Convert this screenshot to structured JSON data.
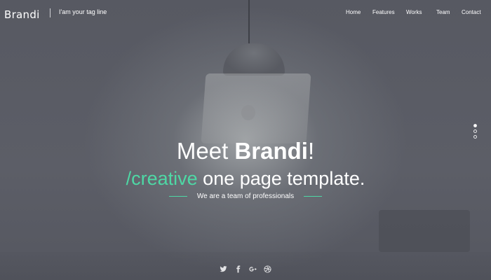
{
  "navbar": {
    "brand": "Brandi",
    "tagline": "I'am your tag line",
    "links": [
      "Home",
      "Features",
      "Works",
      "Team",
      "Contact"
    ]
  },
  "hero": {
    "title_prefix": "Meet ",
    "title_bold": "Brandi",
    "title_suffix": "!",
    "subtitle_accent": "/creative",
    "subtitle_rest": " one page template.",
    "tag": "We are a team of professionals"
  },
  "slider": {
    "active_index": 0,
    "count": 3
  },
  "social": {
    "icons": [
      "twitter-icon",
      "facebook-icon",
      "google-plus-icon",
      "dribbble-icon"
    ]
  },
  "colors": {
    "accent": "#4ed8a5",
    "background": "#5b5d66",
    "text": "#ffffff"
  }
}
